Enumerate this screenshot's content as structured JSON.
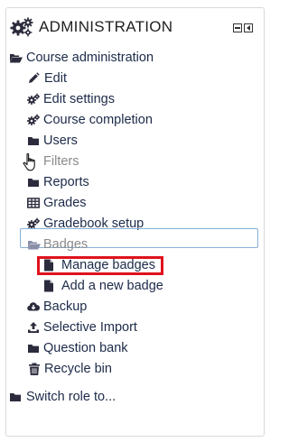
{
  "block": {
    "title": "ADMINISTRATION",
    "icon": "gears-icon",
    "controls": [
      "dock-icon",
      "move-icon"
    ]
  },
  "nav": {
    "course_admin": {
      "label": "Course administration",
      "icon": "folder-open-icon"
    },
    "items": [
      {
        "label": "Edit",
        "icon": "pencil-icon"
      },
      {
        "label": "Edit settings",
        "icon": "gear-icon"
      },
      {
        "label": "Course completion",
        "icon": "gear-icon"
      },
      {
        "label": "Users",
        "icon": "folder-icon"
      },
      {
        "label": "Filters",
        "icon": "hand-cursor-icon"
      },
      {
        "label": "Reports",
        "icon": "folder-icon"
      },
      {
        "label": "Grades",
        "icon": "table-icon"
      },
      {
        "label": "Gradebook setup",
        "icon": "gear-icon"
      },
      {
        "label": "Badges",
        "icon": "folder-open-icon"
      },
      {
        "label": "Manage badges",
        "icon": "file-icon"
      },
      {
        "label": "Add a new badge",
        "icon": "file-icon"
      },
      {
        "label": "Backup",
        "icon": "cloud-download-icon"
      },
      {
        "label": "Selective Import",
        "icon": "upload-icon"
      },
      {
        "label": "Question bank",
        "icon": "folder-icon"
      },
      {
        "label": "Recycle bin",
        "icon": "trash-icon"
      }
    ],
    "switch_role": {
      "label": "Switch role to...",
      "icon": "folder-icon"
    }
  },
  "colors": {
    "link": "#1c2a49",
    "icon": "#2b2b3d",
    "highlight": "#e0121c",
    "focus_border": "#87b1d7"
  }
}
